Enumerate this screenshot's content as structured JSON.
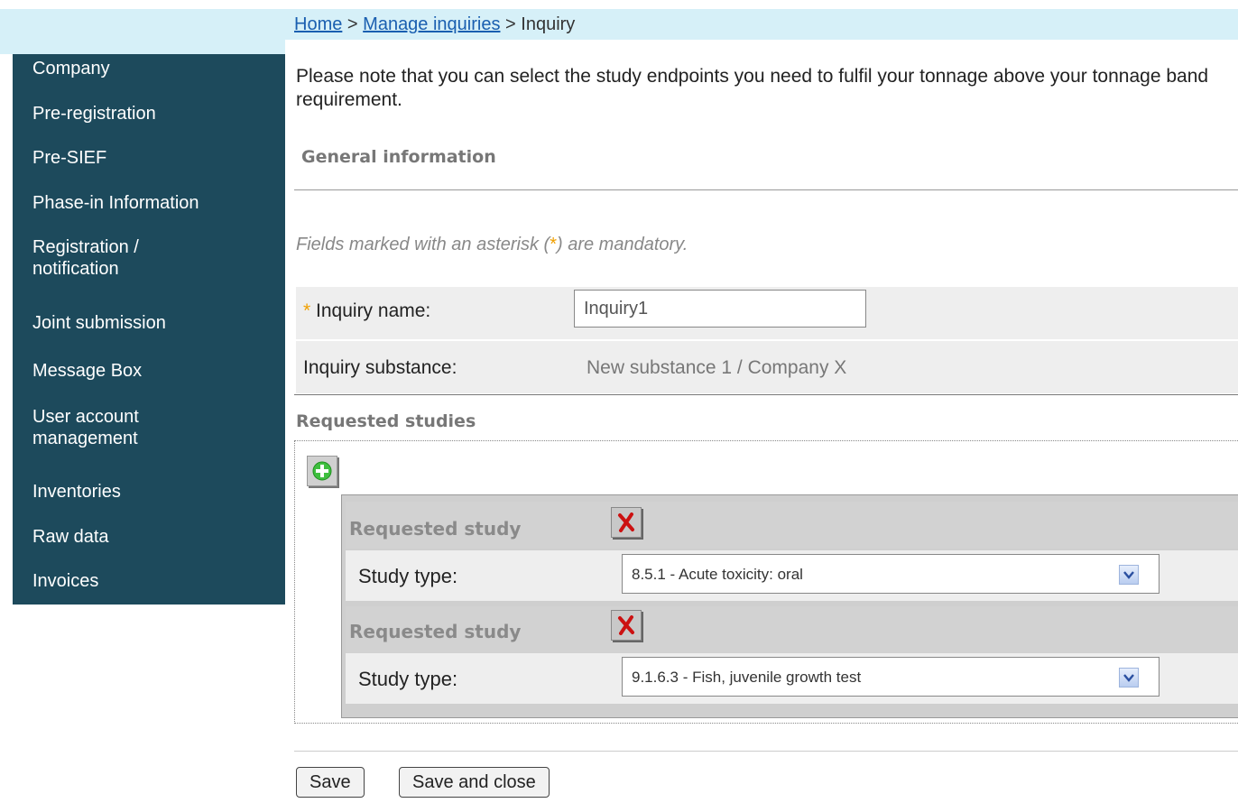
{
  "breadcrumb": {
    "home": "Home",
    "sep1": " > ",
    "manage": "Manage inquiries",
    "sep2": " > Inquiry"
  },
  "sidebar": {
    "items": [
      {
        "label": "Company"
      },
      {
        "label": "Pre-registration"
      },
      {
        "label": "Pre-SIEF"
      },
      {
        "label": "Phase-in Information"
      },
      {
        "label": "Registration / notification"
      },
      {
        "label": "Joint submission"
      },
      {
        "label": "Message Box"
      },
      {
        "label": "User account management"
      },
      {
        "label": "Inventories"
      },
      {
        "label": "Raw data"
      },
      {
        "label": "Invoices"
      }
    ]
  },
  "main": {
    "note": "Please note that you can select the study endpoints you need to fulfil your tonnage above your tonnage band requirement.",
    "general_title": "General information",
    "mandatory_pre": "Fields marked with an asterisk (",
    "mandatory_ast": "*",
    "mandatory_post": ") are mandatory.",
    "inquiry_name_label": "Inquiry name:",
    "inquiry_name_value": "Inquiry1",
    "inquiry_substance_label": "Inquiry substance:",
    "inquiry_substance_value": "New substance 1 / Company X",
    "requested_studies_title": "Requested studies",
    "studies": [
      {
        "title": "Requested study",
        "type_label": "Study type:",
        "type_value": "8.5.1 - Acute toxicity: oral"
      },
      {
        "title": "Requested study",
        "type_label": "Study type:",
        "type_value": "9.1.6.3 - Fish, juvenile growth test"
      }
    ]
  },
  "buttons": {
    "save": "Save",
    "save_close": "Save and close"
  },
  "colors": {
    "sidebar_bg": "#1d4a5c",
    "breadcrumb_bg": "#d6f0f8",
    "asterisk": "#f0a000"
  }
}
